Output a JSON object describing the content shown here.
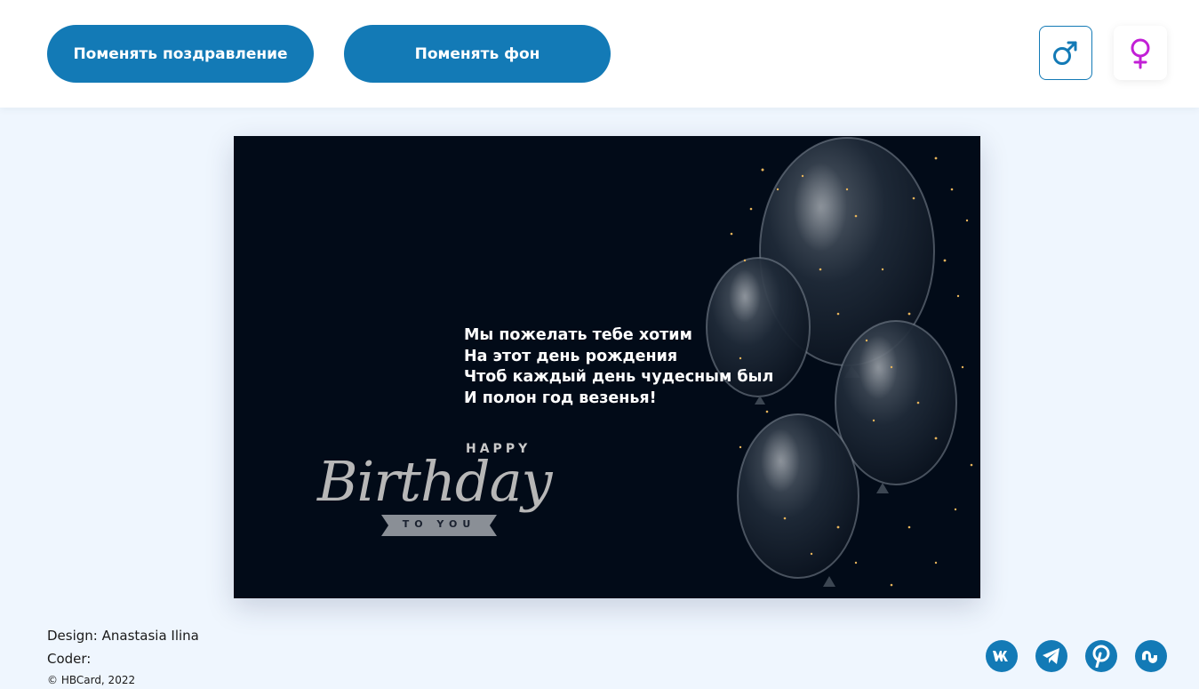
{
  "header": {
    "change_greeting_label": "Поменять поздравление",
    "change_background_label": "Поменять фон",
    "male_symbol": "♂",
    "female_symbol": "♀"
  },
  "card": {
    "poem": [
      "Мы пожелать тебе хотим",
      "На этот день рождения",
      "Чтоб каждый день чудесным был",
      "И полон год везенья!"
    ],
    "happy": "HAPPY",
    "birthday": "Birthday",
    "to_you": "TO YOU"
  },
  "footer": {
    "design": "Design: Anastasia Ilina",
    "coder": "Coder:",
    "copyright": "© HBCard, 2022"
  },
  "social": {
    "vk": "vk-icon",
    "telegram": "telegram-icon",
    "pinterest": "pinterest-icon",
    "stumbleupon": "stumbleupon-icon"
  },
  "colors": {
    "accent": "#137ab6",
    "female": "#c21fd6",
    "card_bg": "#020b18",
    "page_bg": "#eff6fe"
  }
}
